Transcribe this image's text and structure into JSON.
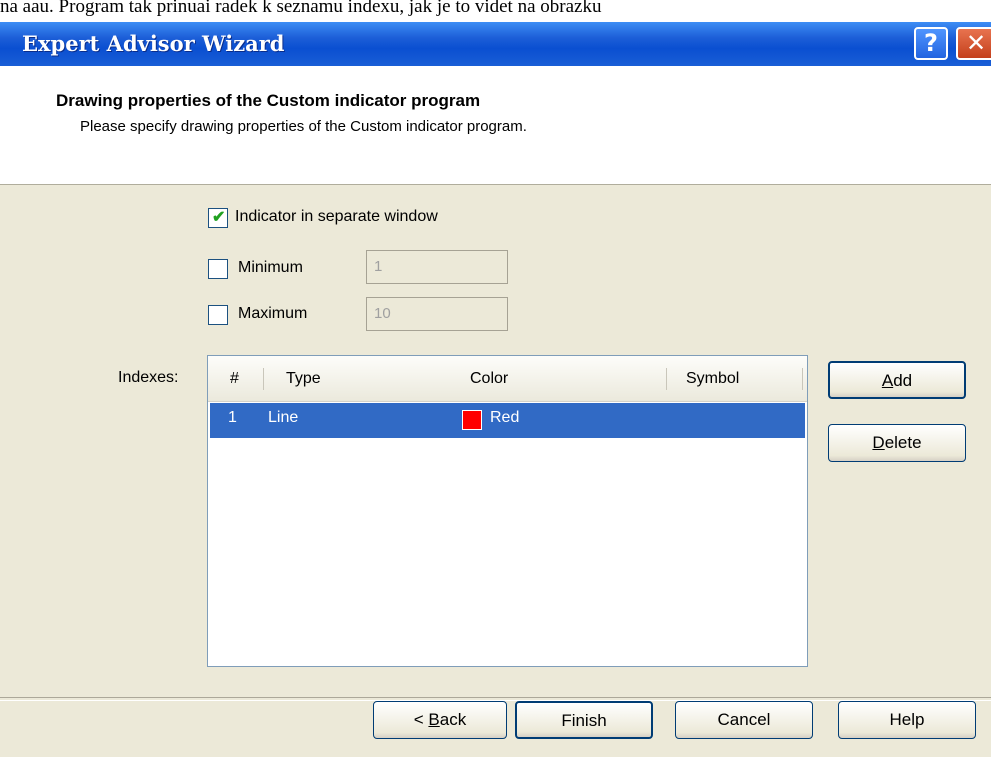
{
  "background_caption": "na aau. Program tak prinuai radek k seznamu indexu, jak je to videt na obrazku",
  "window": {
    "title": "Expert Advisor Wizard",
    "help_glyph": "?",
    "close_glyph": "✕"
  },
  "header": {
    "title": "Drawing properties of the Custom indicator program",
    "subtitle": "Please specify drawing properties of the Custom indicator program."
  },
  "options": {
    "separate_window": {
      "label": "Indicator in separate window",
      "checked": true,
      "tick": "✔"
    },
    "minimum": {
      "label": "Minimum",
      "checked": false,
      "value": "1"
    },
    "maximum": {
      "label": "Maximum",
      "checked": false,
      "value": "10"
    }
  },
  "indexes": {
    "label": "Indexes:",
    "columns": [
      "#",
      "Type",
      "Color",
      "Symbol"
    ],
    "rows": [
      {
        "num": "1",
        "type": "Line",
        "color": "Red",
        "swatch": "#ff0000"
      }
    ]
  },
  "side_buttons": {
    "add": "Add",
    "delete": "Delete"
  },
  "footer_buttons": {
    "back": "< Back",
    "finish": "Finish",
    "cancel": "Cancel",
    "help": "Help"
  },
  "colors": {
    "selection": "#316ac5",
    "titlebar": "#0a4fd1",
    "dialog_bg": "#ece9d8"
  }
}
